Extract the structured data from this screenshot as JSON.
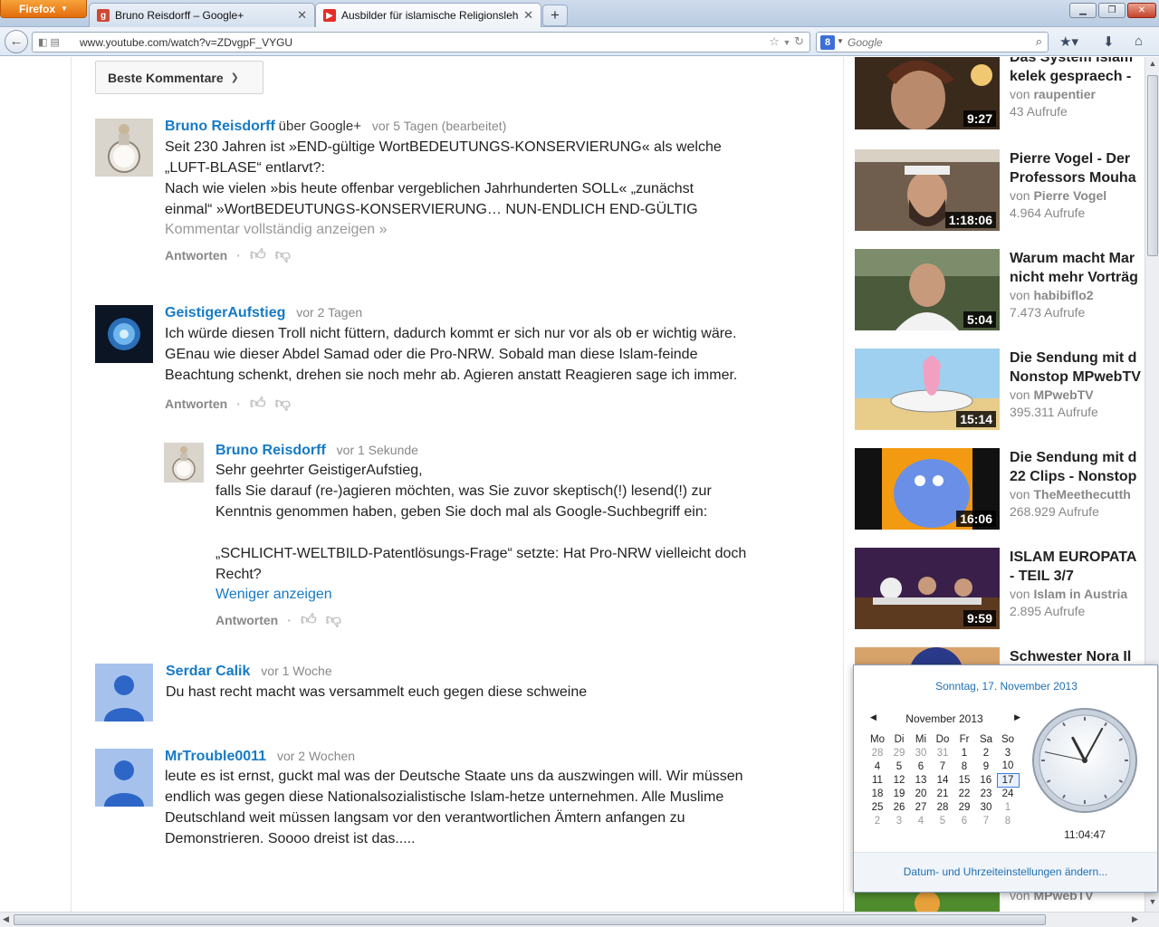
{
  "browser": {
    "firefox_label": "Firefox",
    "tabs": [
      {
        "title": "Bruno Reisdorff – Google+",
        "favicon": "g+"
      },
      {
        "title": "Ausbilder für islamische Religionslehr...",
        "favicon": "youtube"
      }
    ],
    "new_tab": "+",
    "url_prefix": "◧ ▤",
    "url": "www.youtube.com/watch?v=ZDvgpF_VYGU",
    "search_engine": "8",
    "search_placeholder": "Google"
  },
  "sort_button": {
    "label": "Beste Kommentare"
  },
  "comments": [
    {
      "author": "Bruno Reisdorff",
      "via": "über Google+",
      "time": "vor 5 Tagen (bearbeitet)",
      "lines": [
        "Seit 230 Jahren ist »END-gültige WortBEDEUTUNGS-KONSERVIERUNG« als welche",
        "„LUFT-BLASE“ entlarvt?:",
        "Nach wie vielen »bis heute offenbar vergeblichen Jahrhunderten SOLL« „zunächst",
        "einmal“ »WortBEDEUTUNGS-KONSERVIERUNG… NUN-ENDLICH END-GÜLTIG"
      ],
      "more": "Kommentar vollständig anzeigen »",
      "reply": "Antworten"
    },
    {
      "author": "GeistigerAufstieg",
      "time": "vor 2 Tagen",
      "lines": [
        "Ich würde diesen Troll nicht füttern, dadurch kommt er sich nur vor als ob er wichtig wäre.",
        "GEnau wie dieser Abdel Samad oder die Pro-NRW. Sobald man diese Islam-feinde",
        "Beachtung schenkt, drehen sie noch mehr ab. Agieren anstatt Reagieren sage ich immer."
      ],
      "reply": "Antworten"
    },
    {
      "author": "Bruno Reisdorff",
      "time": "vor 1 Sekunde",
      "lines": [
        "Sehr geehrter GeistigerAufstieg,",
        "falls Sie darauf (re-)agieren möchten, was Sie zuvor skeptisch(!) lesend(!) zur",
        "Kenntnis genommen haben, geben Sie doch mal als Google-Suchbegriff ein:",
        "",
        "„SCHLICHT-WELTBILD-Patentlösungs-Frage“ setzte: Hat Pro-NRW vielleicht doch",
        "Recht?"
      ],
      "less": "Weniger anzeigen",
      "reply": "Antworten"
    },
    {
      "author": "Serdar Calik",
      "time": "vor 1 Woche",
      "lines": [
        "Du hast recht macht was versammelt euch gegen diese schweine"
      ]
    },
    {
      "author": "MrTrouble0011",
      "time": "vor 2 Wochen",
      "lines": [
        "leute es ist ernst, guckt mal was der Deutsche Staate uns da auszwingen will. Wir müssen",
        "endlich was gegen diese Nationalsozialistische Islam-hetze unternehmen. Alle Muslime",
        "Deutschland weit müssen langsam vor den verantwortlichen Ämtern anfangen zu",
        "Demonstrieren. Soooo dreist ist das....."
      ]
    }
  ],
  "sidebar": {
    "videos": [
      {
        "title1": "Das System Islam",
        "title2": "kelek gespraech -",
        "by": "von",
        "channel": "raupentier",
        "views": "43 Aufrufe",
        "duration": "9:27"
      },
      {
        "title1": "Pierre Vogel - Der",
        "title2": "Professors Mouha",
        "by": "von",
        "channel": "Pierre Vogel",
        "views": "4.964 Aufrufe",
        "duration": "1:18:06"
      },
      {
        "title1": "Warum macht Mar",
        "title2": "nicht mehr Vorträg",
        "by": "von",
        "channel": "habibiflo2",
        "views": "7.473 Aufrufe",
        "duration": "5:04"
      },
      {
        "title1": "Die Sendung mit d",
        "title2": "Nonstop MPwebTV",
        "by": "von",
        "channel": "MPwebTV",
        "views": "395.311 Aufrufe",
        "duration": "15:14"
      },
      {
        "title1": "Die Sendung mit d",
        "title2": "22 Clips - Nonstop",
        "by": "von",
        "channel": "TheMeethecutth",
        "views": "268.929 Aufrufe",
        "duration": "16:06"
      },
      {
        "title1": "ISLAM EUROPATA",
        "title2": "- TEIL 3/7",
        "by": "von",
        "channel": "Islam in Austria",
        "views": "2.895 Aufrufe",
        "duration": "9:59"
      },
      {
        "title1": "Schwester Nora Il",
        "title2": "",
        "by": "",
        "channel": "",
        "views": "",
        "duration": ""
      }
    ],
    "last_partial": {
      "by": "von",
      "channel": "MPwebTV"
    }
  },
  "calendar": {
    "full_date": "Sonntag, 17. November 2013",
    "month": "November 2013",
    "weekdays": [
      "Mo",
      "Di",
      "Mi",
      "Do",
      "Fr",
      "Sa",
      "So"
    ],
    "weeks": [
      [
        "28",
        "29",
        "30",
        "31",
        "1",
        "2",
        "3"
      ],
      [
        "4",
        "5",
        "6",
        "7",
        "8",
        "9",
        "10"
      ],
      [
        "11",
        "12",
        "13",
        "14",
        "15",
        "16",
        "17"
      ],
      [
        "18",
        "19",
        "20",
        "21",
        "22",
        "23",
        "24"
      ],
      [
        "25",
        "26",
        "27",
        "28",
        "29",
        "30",
        "1"
      ],
      [
        "2",
        "3",
        "4",
        "5",
        "6",
        "7",
        "8"
      ]
    ],
    "time": "11:04:47",
    "settings_link": "Datum- und Uhrzeiteinstellungen ändern..."
  }
}
